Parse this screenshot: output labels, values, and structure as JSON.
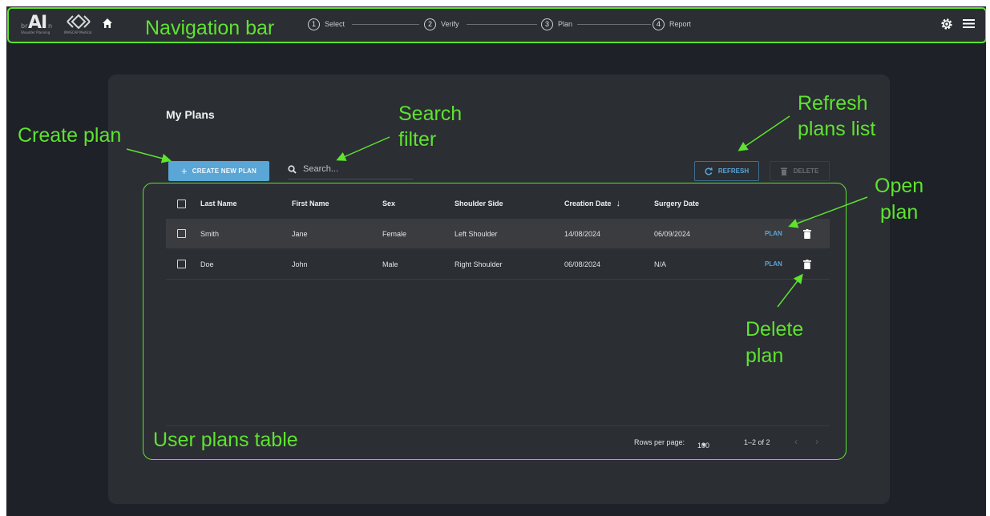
{
  "colors": {
    "annotation": "#5ee32f",
    "accent": "#5aa6d6",
    "background": "#1e2127",
    "panel": "#2b2e33"
  },
  "navbar": {
    "logo_main": "AI",
    "logo_prefix": "br",
    "logo_suffix": "n",
    "logo_caption": "Shoulder Planning",
    "partner_caption": "IMASCAP Medical",
    "steps": [
      {
        "number": "1",
        "label": "Select"
      },
      {
        "number": "2",
        "label": "Verify"
      },
      {
        "number": "3",
        "label": "Plan"
      },
      {
        "number": "4",
        "label": "Report"
      }
    ],
    "icons": [
      "home-icon",
      "gear-icon",
      "menu-icon"
    ]
  },
  "page": {
    "title": "My Plans",
    "create_button": "CREATE NEW PLAN",
    "search_placeholder": "Search...",
    "refresh_button": "REFRESH",
    "delete_button": "DELETE"
  },
  "table": {
    "columns": [
      "Last Name",
      "First Name",
      "Sex",
      "Shoulder Side",
      "Creation Date",
      "Surgery Date"
    ],
    "sort_indicator": "↓",
    "rows": [
      {
        "last_name": "Smith",
        "first_name": "Jane",
        "sex": "Female",
        "shoulder_side": "Left Shoulder",
        "creation_date": "14/08/2024",
        "surgery_date": "06/09/2024",
        "action": "PLAN"
      },
      {
        "last_name": "Doe",
        "first_name": "John",
        "sex": "Male",
        "shoulder_side": "Right Shoulder",
        "creation_date": "06/08/2024",
        "surgery_date": "N/A",
        "action": "PLAN"
      }
    ],
    "footer": {
      "rows_per_page_label": "Rows per page:",
      "rows_per_page_value": "100",
      "range": "1–2 of 2"
    }
  },
  "annotations": {
    "nav": "Navigation bar",
    "create": "Create plan",
    "search_1": "Search",
    "search_2": "filter",
    "refresh_1": "Refresh",
    "refresh_2": "plans list",
    "open_1": "Open",
    "open_2": "plan",
    "delete_1": "Delete",
    "delete_2": "plan",
    "table": "User plans table"
  }
}
